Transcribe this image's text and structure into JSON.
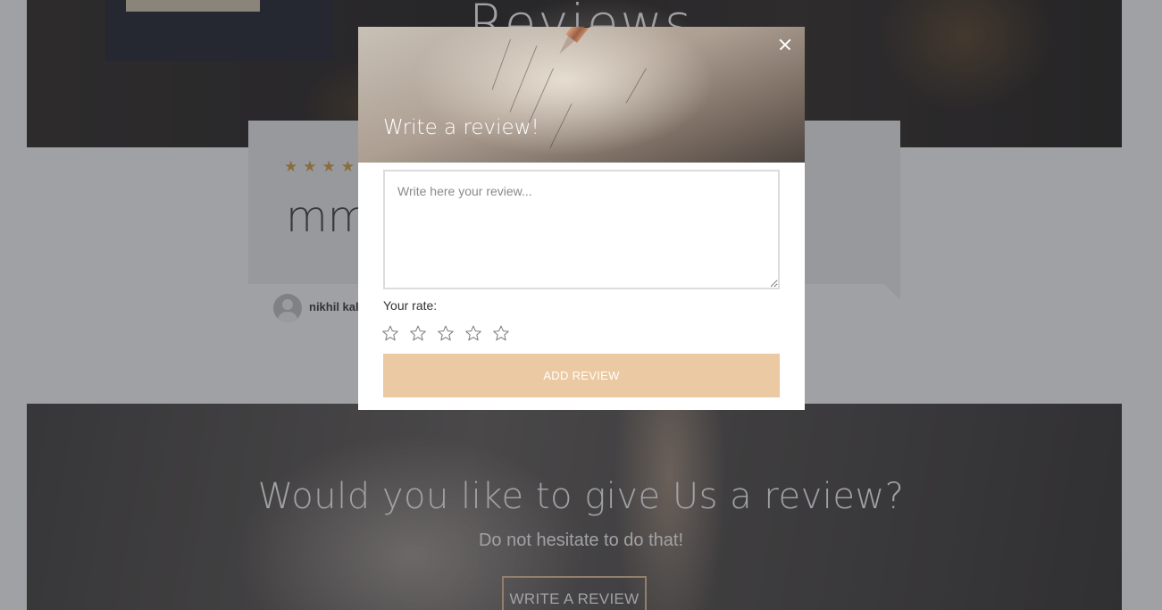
{
  "hero": {
    "title": "Reviews"
  },
  "review": {
    "rating": 4,
    "stars": "★★★★",
    "text": "mm",
    "author": "nikhil kale"
  },
  "cta": {
    "title": "Would you like to give Us a review?",
    "subtitle": "Do not hesitate to do that!",
    "button_label": "Write a review"
  },
  "modal": {
    "title": "Write a review!",
    "textarea_placeholder": "Write here your review...",
    "rate_label": "Your rate:",
    "rate_value": 0,
    "rate_max": 5,
    "submit_label": "Add review"
  },
  "colors": {
    "accent": "#ebc9a2",
    "star_filled": "#d7a54a",
    "star_empty": "#7a7a7a"
  },
  "icons": {
    "close": "close-icon",
    "star": "star-outline-icon"
  }
}
